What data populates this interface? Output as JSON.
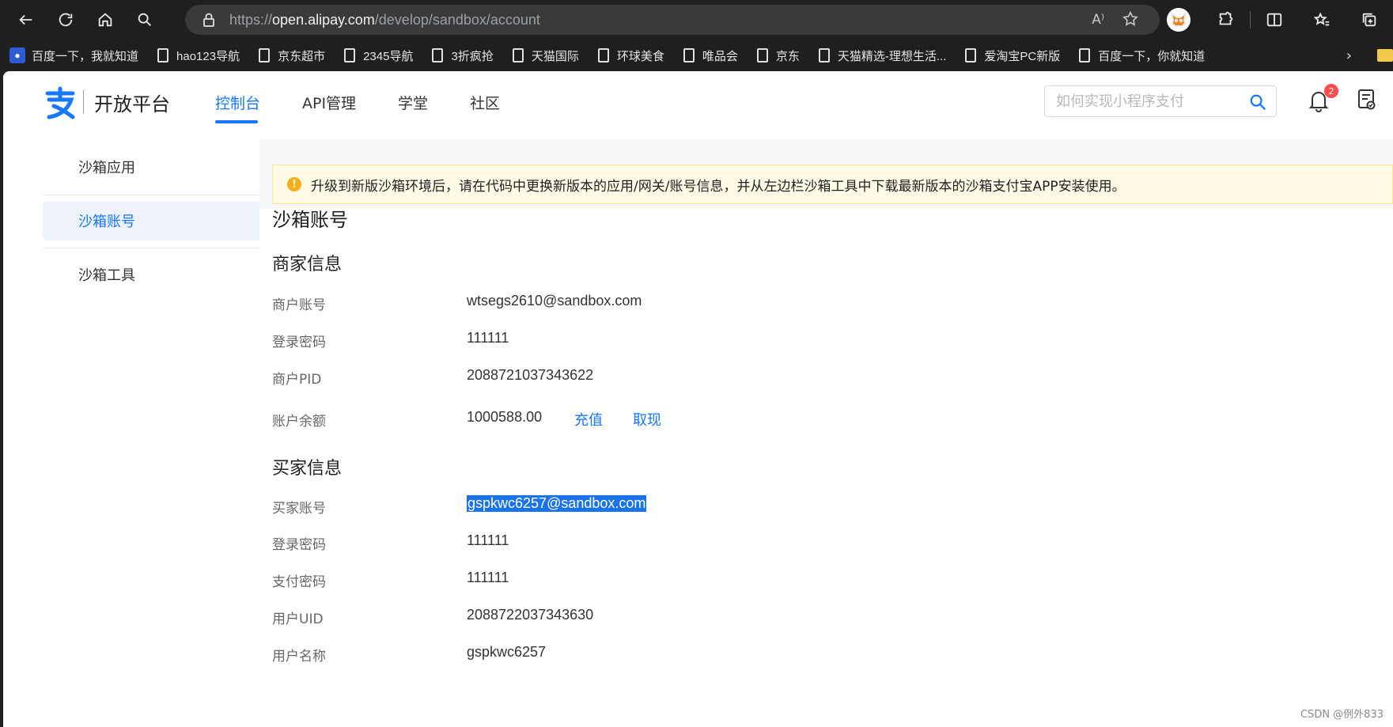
{
  "browser": {
    "url_prefix": "https://",
    "url_host": "open.alipay.com",
    "url_path": "/develop/sandbox/account",
    "read_aloud": "A⁾"
  },
  "bookmarks": [
    "百度一下，我就知道",
    "hao123导航",
    "京东超市",
    "2345导航",
    "3折疯抢",
    "天猫国际",
    "环球美食",
    "唯品会",
    "京东",
    "天猫精选-理想生活...",
    "爱淘宝PC新版",
    "百度一下，你就知道"
  ],
  "header": {
    "logo_text": "开放平台",
    "nav": [
      "控制台",
      "API管理",
      "学堂",
      "社区"
    ],
    "search_placeholder": "如何实现小程序支付",
    "notification_count": "2"
  },
  "sidebar": {
    "items": [
      "沙箱应用",
      "沙箱账号",
      "沙箱工具"
    ]
  },
  "alert": {
    "text": "升级到新版沙箱环境后，请在代码中更换新版本的应用/网关/账号信息，并从左边栏沙箱工具中下载最新版本的沙箱支付宝APP安装使用。"
  },
  "main": {
    "title": "沙箱账号",
    "merchant": {
      "heading": "商家信息",
      "rows": [
        {
          "label": "商户账号",
          "value": "wtsegs2610@sandbox.com"
        },
        {
          "label": "登录密码",
          "value": "111111"
        },
        {
          "label": "商户PID",
          "value": "2088721037343622"
        },
        {
          "label": "账户余额",
          "value": "1000588.00"
        }
      ],
      "recharge": "充值",
      "withdraw": "取现"
    },
    "buyer": {
      "heading": "买家信息",
      "rows": [
        {
          "label": "买家账号",
          "value": "gspkwc6257@sandbox.com"
        },
        {
          "label": "登录密码",
          "value": "111111"
        },
        {
          "label": "支付密码",
          "value": "111111"
        },
        {
          "label": "用户UID",
          "value": "2088722037343630"
        },
        {
          "label": "用户名称",
          "value": "gspkwc6257"
        }
      ]
    }
  },
  "watermark": "CSDN @例外833"
}
